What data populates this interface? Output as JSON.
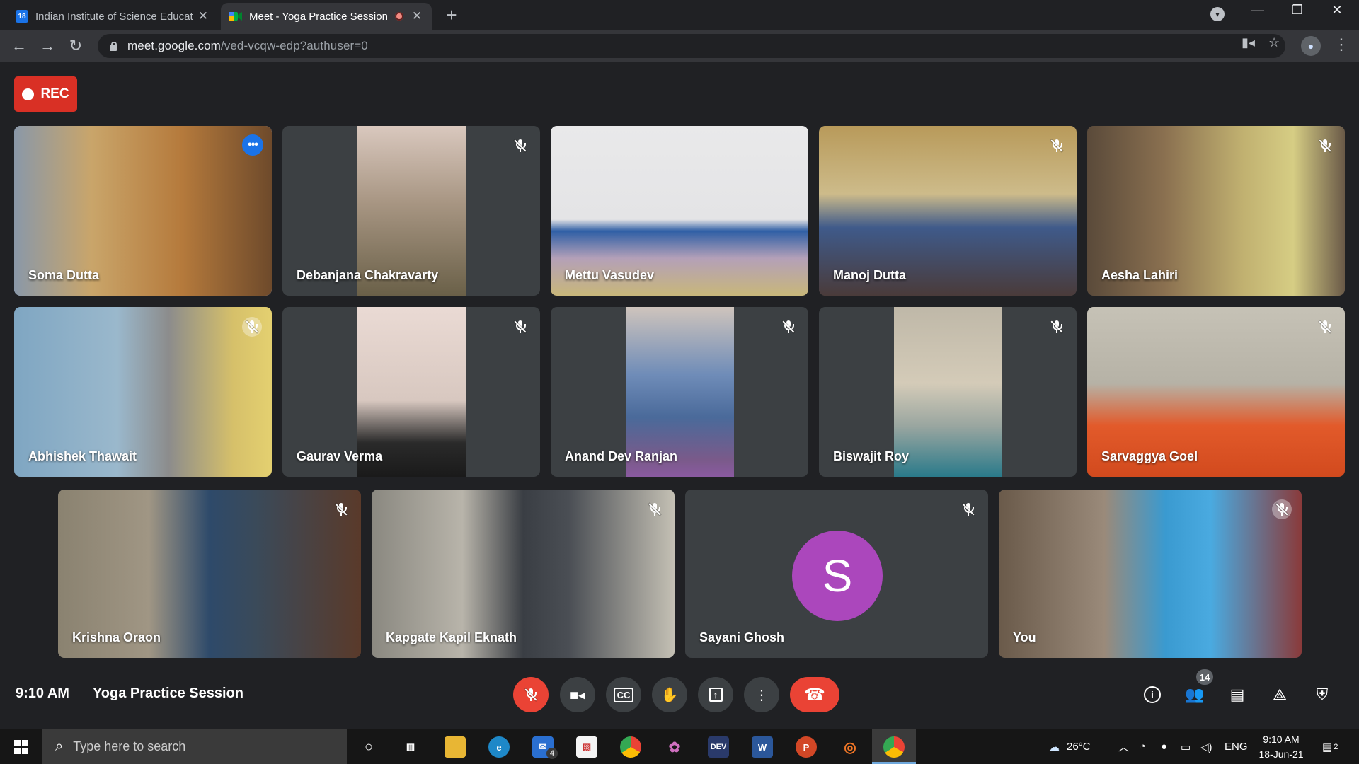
{
  "browser": {
    "tabs": [
      {
        "title": "Indian Institute of Science Educat",
        "favicon": "calendar-18-icon",
        "favicon_text": "18",
        "active": false
      },
      {
        "title": "Meet - Yoga Practice Session",
        "favicon": "google-meet-icon",
        "active": true,
        "recording_indicator": true
      }
    ],
    "url_host": "meet.google.com",
    "url_path": "/ved-vcqw-edp?authuser=0"
  },
  "meeting": {
    "rec_label": "REC",
    "time": "9:10 AM",
    "title": "Yoga Practice Session",
    "participant_count": "14",
    "participants": [
      {
        "name": "Soma Dutta",
        "speaking": true
      },
      {
        "name": "Debanjana Chakravarty",
        "muted": true
      },
      {
        "name": "Mettu Vasudev"
      },
      {
        "name": "Manoj Dutta",
        "muted": true
      },
      {
        "name": "Aesha Lahiri",
        "muted": true
      },
      {
        "name": "Abhishek Thawait",
        "muted": true
      },
      {
        "name": "Gaurav Verma",
        "muted": true
      },
      {
        "name": "Anand Dev Ranjan",
        "muted": true
      },
      {
        "name": "Biswajit Roy",
        "muted": true
      },
      {
        "name": "Sarvaggya Goel",
        "muted": true
      },
      {
        "name": "Krishna Oraon",
        "muted": true
      },
      {
        "name": "Kapgate Kapil Eknath",
        "muted": true
      },
      {
        "name": "Sayani Ghosh",
        "muted": true,
        "avatar_letter": "S",
        "avatar_color": "#ab47bc"
      },
      {
        "name": "You",
        "muted": true
      }
    ]
  },
  "colors": {
    "meet_bg": "#202124",
    "tile_bg": "#3c4043",
    "accent_red": "#ea4335",
    "speaking_border": "#8ab4f8"
  },
  "taskbar": {
    "search_placeholder": "Type here to search",
    "mail_badge": "4",
    "weather": "26°C",
    "language": "ENG",
    "time": "9:10 AM",
    "date": "18-Jun-21",
    "notification_count": "2"
  }
}
